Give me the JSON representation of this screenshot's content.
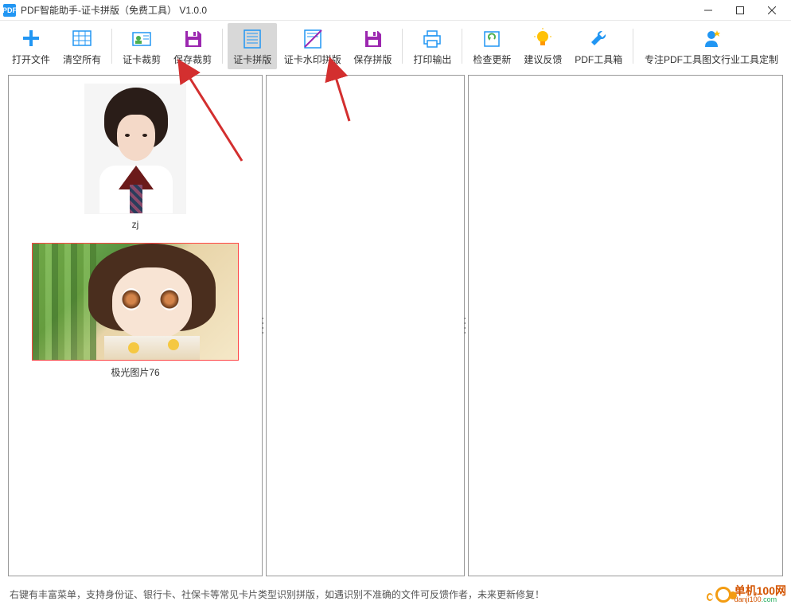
{
  "window": {
    "icon_text": "PDF",
    "title": "PDF智能助手-证卡拼版（免费工具） V1.0.0"
  },
  "toolbar": {
    "open": "打开文件",
    "clear": "清空所有",
    "crop": "证卡裁剪",
    "save_crop": "保存裁剪",
    "compose": "证卡拼版",
    "watermark": "证卡水印拼版",
    "save_compose": "保存拼版",
    "print": "打印输出",
    "check_update": "检查更新",
    "feedback": "建议反馈",
    "toolbox": "PDF工具箱",
    "custom": "专注PDF工具图文行业工具定制"
  },
  "thumbs": [
    {
      "label": "zj"
    },
    {
      "label": "极光图片76"
    }
  ],
  "statusbar": {
    "text": "右键有丰富菜单，支持身份证、银行卡、社保卡等常见卡片类型识别拼版，如遇识别不准确的文件可反馈作者，未来更新修复！"
  },
  "watermark": {
    "cn": "单机100网",
    "en_prefix": "danji100",
    "en_suffix": ".com"
  },
  "colors": {
    "accent_blue": "#2196f3",
    "accent_purple": "#9c27b0",
    "accent_orange": "#ff9800",
    "arrow_red": "#d32f2f"
  }
}
